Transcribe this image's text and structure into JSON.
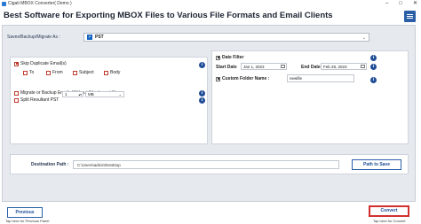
{
  "window": {
    "title": "Cigati MBOX Converter( Demo )",
    "controls": [
      "–",
      "□",
      "✕"
    ]
  },
  "header": {
    "title": "Best Software for Exporting MBOX Files to Various File Formats and Email Clients",
    "menu_icon": "hamburger-menu-icon"
  },
  "save_as": {
    "label": "Saves/Backup/Migrate As :",
    "selected": "PST",
    "icon": "pst-file-icon",
    "arrow": "⌄"
  },
  "options": {
    "skip_duplicates": {
      "label": "Skip Duplicate Email(s)",
      "checked": true
    },
    "fields": [
      {
        "label": "To",
        "checked": false
      },
      {
        "label": "From",
        "checked": false
      },
      {
        "label": "Subject",
        "checked": false
      },
      {
        "label": "Body",
        "checked": false
      }
    ],
    "without_attachment": {
      "label": "Migrate or Backup Emails Without Attachment files",
      "checked": false
    },
    "split_pst": {
      "label": "Split Resultant PST",
      "checked": false,
      "size": "1",
      "unit": "MB",
      "stepper": "▴▾"
    }
  },
  "filter": {
    "date_filter": {
      "label": "Date Filter",
      "checked": true
    },
    "start_label": "Start Date",
    "start_value": "Jan 1, 2023",
    "end_label": "End Date",
    "end_value": "Feb 28, 2023",
    "custom_folder": {
      "label": "Custom Folder Name :",
      "checked": true,
      "value": "newfile"
    }
  },
  "info_glyph": "i",
  "destination": {
    "label": "Destination Path :",
    "value": "C:\\Users\\admin\\Desktop",
    "button": "Path to Save"
  },
  "footer": {
    "previous": "Previous",
    "previous_hint": "Tap here for Previous Panel",
    "convert": "Convert",
    "convert_hint": "Tap here for Convert"
  },
  "colors": {
    "accent": "#2a5fa8",
    "checkbox_red": "#c0392b",
    "convert_highlight": "#d32f2f"
  }
}
